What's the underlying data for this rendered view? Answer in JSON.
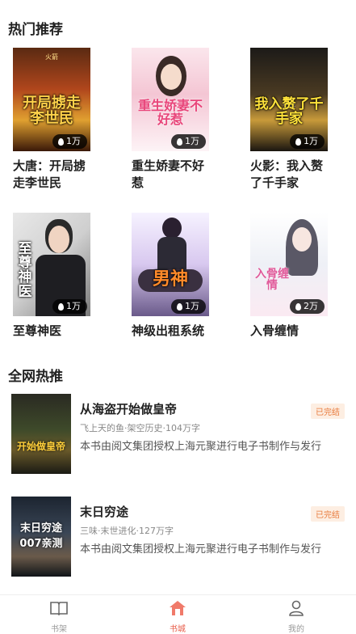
{
  "hot": {
    "title": "热门推荐",
    "books": [
      {
        "title": "大唐：开局掳走李世民",
        "cover_text": "开局掳走李世民",
        "cover_tag": "火箭",
        "reads": "1万"
      },
      {
        "title": "重生娇妻不好惹",
        "cover_text": "重生娇妻不好惹",
        "cover_tag": "",
        "reads": "1万"
      },
      {
        "title": "火影：我入赘了千手家",
        "cover_text": "我入赘了千手家",
        "cover_tag": "火影",
        "reads": "1万"
      },
      {
        "title": "至尊神医",
        "cover_text": "至尊神医",
        "cover_tag": "",
        "reads": "1万"
      },
      {
        "title": "神级出租系统",
        "cover_text": "男神",
        "cover_tag": "",
        "reads": "1万"
      },
      {
        "title": "入骨缠情",
        "cover_text": "入骨缠情",
        "cover_tag": "",
        "reads": "2万"
      }
    ]
  },
  "network": {
    "title": "全网热推",
    "books": [
      {
        "title": "从海盗开始做皇帝",
        "status": "已完结",
        "meta": "飞上天的鱼·架空历史·104万字",
        "desc": "本书由阅文集团授权上海元聚进行电子书制作与发行",
        "cover_text": "开始做皇帝"
      },
      {
        "title": "末日穷途",
        "status": "已完结",
        "meta": "三味·末世进化·127万字",
        "desc": "本书由阅文集团授权上海元聚进行电子书制作与发行",
        "cover_text": "末日穷途 007亲测"
      }
    ]
  },
  "tabbar": {
    "tabs": [
      {
        "label": "书架",
        "icon": "book-icon"
      },
      {
        "label": "书城",
        "icon": "home-icon",
        "active": true
      },
      {
        "label": "我的",
        "icon": "user-icon"
      }
    ]
  },
  "colors": {
    "accent": "#e85d4a",
    "status": "#e87a3c"
  }
}
